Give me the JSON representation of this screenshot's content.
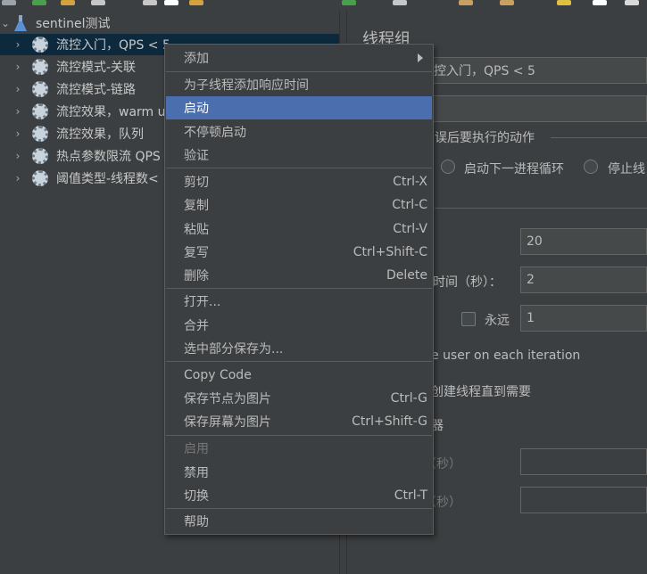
{
  "tree": {
    "root_label": "sentinel测试",
    "nodes": [
      {
        "label": "流控入门，QPS < 5"
      },
      {
        "label": "流控模式-关联"
      },
      {
        "label": "流控模式-链路"
      },
      {
        "label": "流控效果，warm up"
      },
      {
        "label": "流控效果，队列"
      },
      {
        "label": "热点参数限流 QPS"
      },
      {
        "label": "阈值类型-线程数<"
      }
    ]
  },
  "panel": {
    "title": "线程组",
    "name_value": "控入门，QPS < 5",
    "comment_value": "",
    "action_section": "误后要执行的动作",
    "radio_next_loop": "启动下一进程循环",
    "radio_stop_thread": "停止线",
    "threads_value": "20",
    "rampup_label": "时间（秒）：",
    "rampup_value": "2",
    "forever_label": "永远",
    "loop_value": "1",
    "same_user_label": "e user on each iteration",
    "delay_create_label": "创建线程直到需要",
    "scheduler_label": "器",
    "duration_label": "（秒）",
    "startup_delay_label": "（秒）",
    "duration_value": "",
    "startup_delay_value": ""
  },
  "context_menu": {
    "items": [
      {
        "label": "添加",
        "shortcut": "",
        "submenu": true,
        "state": "normal"
      },
      {
        "label": "为子线程添加响应时间",
        "shortcut": "",
        "state": "normal"
      },
      {
        "label": "启动",
        "shortcut": "",
        "state": "hover"
      },
      {
        "label": "不停顿启动",
        "shortcut": "",
        "state": "normal"
      },
      {
        "label": "验证",
        "shortcut": "",
        "state": "normal"
      },
      {
        "label": "剪切",
        "shortcut": "Ctrl-X",
        "state": "normal"
      },
      {
        "label": "复制",
        "shortcut": "Ctrl-C",
        "state": "normal"
      },
      {
        "label": "粘贴",
        "shortcut": "Ctrl-V",
        "state": "normal"
      },
      {
        "label": "复写",
        "shortcut": "Ctrl+Shift-C",
        "state": "normal"
      },
      {
        "label": "删除",
        "shortcut": "Delete",
        "state": "normal"
      },
      {
        "label": "打开...",
        "shortcut": "",
        "state": "normal"
      },
      {
        "label": "合并",
        "shortcut": "",
        "state": "normal"
      },
      {
        "label": "选中部分保存为...",
        "shortcut": "",
        "state": "normal"
      },
      {
        "label": "Copy Code",
        "shortcut": "",
        "state": "normal"
      },
      {
        "label": "保存节点为图片",
        "shortcut": "Ctrl-G",
        "state": "normal"
      },
      {
        "label": "保存屏幕为图片",
        "shortcut": "Ctrl+Shift-G",
        "state": "normal"
      },
      {
        "label": "启用",
        "shortcut": "",
        "state": "disabled"
      },
      {
        "label": "禁用",
        "shortcut": "",
        "state": "normal"
      },
      {
        "label": "切换",
        "shortcut": "Ctrl-T",
        "state": "normal"
      },
      {
        "label": "帮助",
        "shortcut": "",
        "state": "normal"
      }
    ]
  },
  "colors": {
    "background": "#3c3f41",
    "menu_hover": "#4b6eaf",
    "tree_selected": "#0d293e"
  }
}
